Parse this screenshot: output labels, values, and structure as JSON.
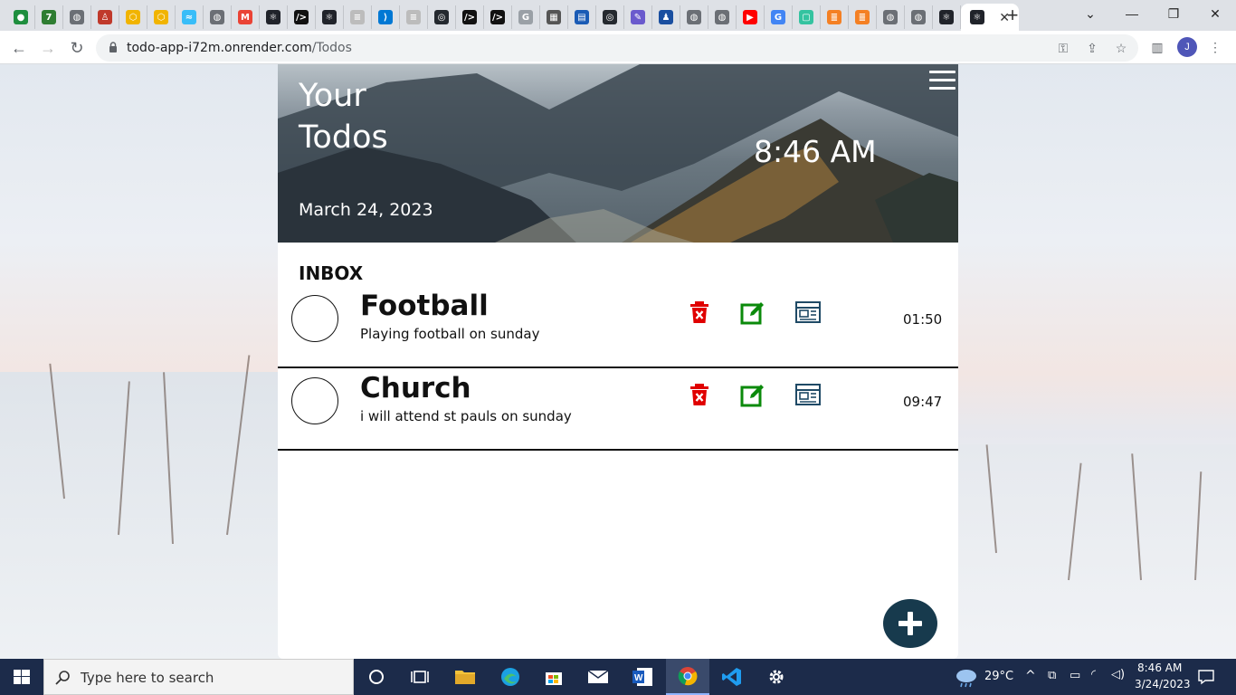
{
  "browser": {
    "tabs": [
      {
        "icon": "green-leaf-icon",
        "color": "#1e8e3e"
      },
      {
        "icon": "seven-app-icon",
        "color": "#2e7d32"
      },
      {
        "icon": "globe-icon",
        "color": "#6b6f75"
      },
      {
        "icon": "person-flag-icon",
        "color": "#c0392b"
      },
      {
        "icon": "yellow-hex-icon",
        "color": "#f1b400"
      },
      {
        "icon": "yellow-hex-icon",
        "color": "#f1b400"
      },
      {
        "icon": "tailwind-icon",
        "color": "#38bdf8"
      },
      {
        "icon": "globe-icon",
        "color": "#6b6f75"
      },
      {
        "icon": "gmail-icon",
        "color": "#ea4335"
      },
      {
        "icon": "react-icon",
        "color": "#20232a"
      },
      {
        "icon": "code-editor-icon",
        "color": "#111111"
      },
      {
        "icon": "react-icon",
        "color": "#20232a"
      },
      {
        "icon": "stack-icon",
        "color": "#bcbcbc"
      },
      {
        "icon": "vscode-icon",
        "color": "#0078d4"
      },
      {
        "icon": "stack-icon",
        "color": "#bcbcbc"
      },
      {
        "icon": "github-icon",
        "color": "#24292f"
      },
      {
        "icon": "code-editor-icon",
        "color": "#111111"
      },
      {
        "icon": "code-editor-icon",
        "color": "#111111"
      },
      {
        "icon": "google-icon",
        "color": "#9aa0a6"
      },
      {
        "icon": "grid-icon",
        "color": "#555555"
      },
      {
        "icon": "chart-app-icon",
        "color": "#1a5bb5"
      },
      {
        "icon": "github-icon",
        "color": "#24292f"
      },
      {
        "icon": "pen-icon",
        "color": "#6a5acd"
      },
      {
        "icon": "figure-icon",
        "color": "#1a4fa0"
      },
      {
        "icon": "globe-icon",
        "color": "#6b6f75"
      },
      {
        "icon": "globe-icon",
        "color": "#6b6f75"
      },
      {
        "icon": "youtube-icon",
        "color": "#ff0000"
      },
      {
        "icon": "google-icon",
        "color": "#4285f4"
      },
      {
        "icon": "sheet-icon",
        "color": "#34c3a0"
      },
      {
        "icon": "stackoverflow-icon",
        "color": "#f48024"
      },
      {
        "icon": "stackoverflow-icon",
        "color": "#f48024"
      },
      {
        "icon": "globe-icon",
        "color": "#6b6f75"
      },
      {
        "icon": "globe-icon",
        "color": "#6b6f75"
      },
      {
        "icon": "react-icon",
        "color": "#20232a"
      }
    ],
    "active_tab_icon": "react-icon",
    "url_host": "todo-app-i72m.onrender.com",
    "url_path": "/Todos",
    "profile_initial": "J"
  },
  "app": {
    "title": "Your Todos",
    "date": "March 24, 2023",
    "time": "8:46 AM",
    "section": "INBOX",
    "accent_color": "#173a4d",
    "delete_color": "#e00000",
    "edit_color": "#0b8a0b",
    "todos": [
      {
        "title": "Football",
        "description": "Playing football on sunday",
        "time": "01:50"
      },
      {
        "title": "Church",
        "description": "i will attend st pauls on sunday",
        "time": "09:47"
      }
    ]
  },
  "taskbar": {
    "search_placeholder": "Type here to search",
    "weather": "29°C",
    "clock_time": "8:46 AM",
    "clock_date": "3/24/2023"
  }
}
